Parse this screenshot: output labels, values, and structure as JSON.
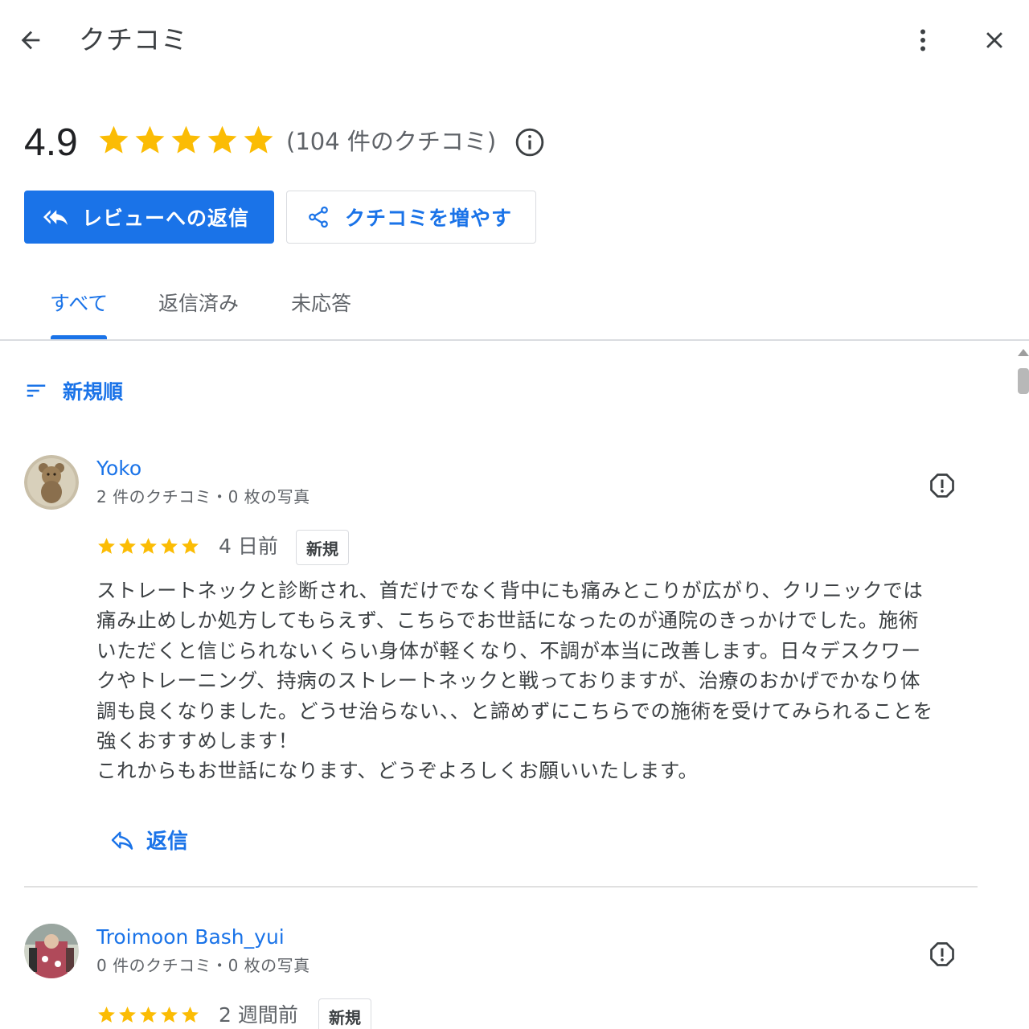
{
  "header": {
    "title": "クチコミ",
    "back_icon": "arrow-back-icon",
    "more_icon": "more-vert-icon",
    "close_icon": "close-icon"
  },
  "summary": {
    "rating": "4.9",
    "stars": 5,
    "review_count_text": "(104 件のクチコミ)",
    "star_color": "#fbbc04"
  },
  "actions": {
    "reply_label": "レビューへの返信",
    "get_more_label": "クチコミを増やす",
    "accent_color": "#1a73e8"
  },
  "tabs": [
    {
      "label": "すべて",
      "active": true
    },
    {
      "label": "返信済み",
      "active": false
    },
    {
      "label": "未応答",
      "active": false
    }
  ],
  "sort": {
    "label": "新規順"
  },
  "reviews": [
    {
      "name": "Yoko",
      "meta": "2 件のクチコミ・0 枚の写真",
      "stars": 5,
      "date": "4 日前",
      "badge": "新規",
      "text": "ストレートネックと診断され、首だけでなく背中にも痛みとこりが広がり、クリニックでは\n痛み止めしか処方してもらえず、こちらでお世話になったのが通院のきっかけでした。施術\nいただくと信じられないくらい身体が軽くなり、不調が本当に改善します。日々デスクワー\nクやトレーニング、持病のストレートネックと戦っておりますが、治療のおかげでかなり体\n調も良くなりました。どうせ治らない、、と諦めずにこちらでの施術を受けてみられることを\n強くおすすめします！\nこれからもお世話になります、どうぞよろしくお願いいたします。",
      "reply_label": "返信"
    },
    {
      "name": "Troimoon Bash_yui",
      "meta": "0 件のクチコミ・0 枚の写真",
      "stars": 5,
      "date": "2 週間前",
      "badge": "新規"
    }
  ]
}
